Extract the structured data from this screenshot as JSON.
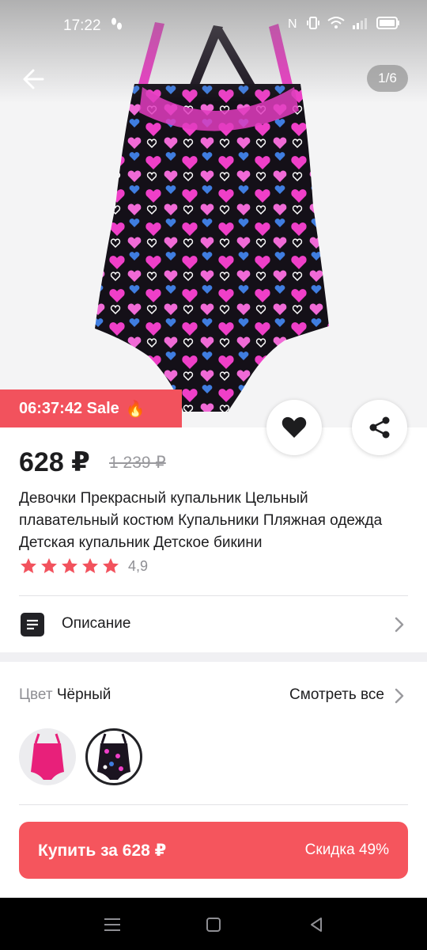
{
  "status_bar": {
    "time": "17:22",
    "icons": [
      "footsteps-icon",
      "nfc-icon",
      "vibrate-icon",
      "wifi-icon",
      "signal-icon",
      "battery-icon"
    ]
  },
  "gallery": {
    "counter": "1/6"
  },
  "sale_banner": {
    "text": "06:37:42 Sale",
    "emoji": "🔥",
    "color": "#f2525d"
  },
  "product": {
    "price": "628 ₽",
    "old_price": "1 239 ₽",
    "title": "Девочки Прекрасный купальник Цельный плавательный костюм Купальники Пляжная одежда Детская купальник Детское бикини",
    "rating": 4.9,
    "rating_label": "4,9",
    "stars": 5
  },
  "description_row": {
    "label": "Описание"
  },
  "color_section": {
    "label": "Цвет",
    "selected": "Чёрный",
    "view_all": "Смотреть все",
    "options": [
      {
        "name": "pink",
        "swatch": "#e8207a"
      },
      {
        "name": "black",
        "swatch": "#1b1420"
      }
    ]
  },
  "buy_button": {
    "label": "Купить за 628 ₽",
    "discount": "Скидка 49%",
    "color": "#f5555d"
  },
  "colors": {
    "accent": "#f5555d",
    "star": "#f2525d"
  }
}
